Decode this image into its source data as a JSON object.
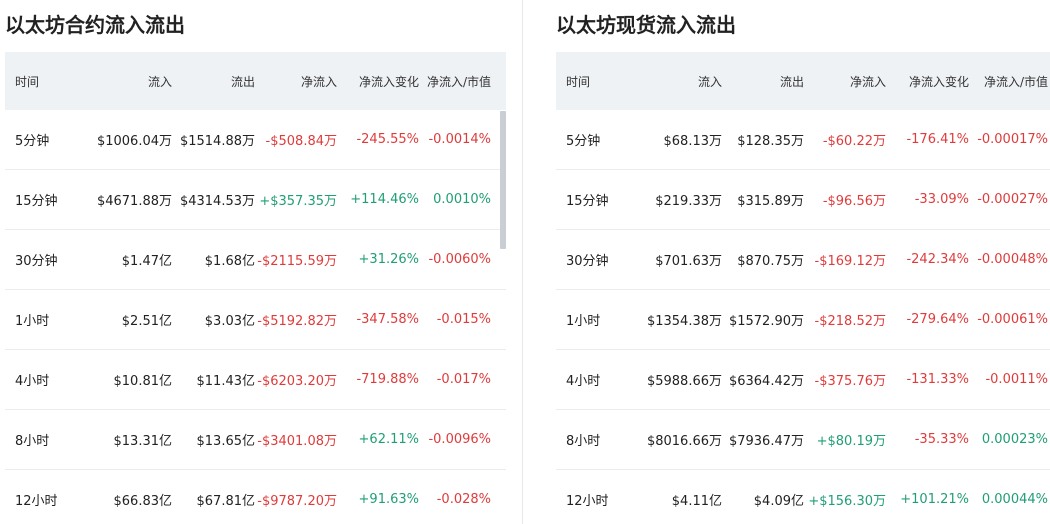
{
  "colors": {
    "negative": "#e03b3b",
    "positive": "#1f9e77",
    "header_bg": "#eff2f5"
  },
  "panels": [
    {
      "title": "以太坊合约流入流出",
      "columns": [
        "时间",
        "流入",
        "流出",
        "净流入",
        "净流入变化",
        "净流入/市值"
      ],
      "rows": [
        [
          "5分钟",
          "$1006.04万",
          "$1514.88万",
          "-$508.84万",
          "-245.55%",
          "-0.0014%"
        ],
        [
          "15分钟",
          "$4671.88万",
          "$4314.53万",
          "+$357.35万",
          "+114.46%",
          "0.0010%"
        ],
        [
          "30分钟",
          "$1.47亿",
          "$1.68亿",
          "-$2115.59万",
          "+31.26%",
          "-0.0060%"
        ],
        [
          "1小时",
          "$2.51亿",
          "$3.03亿",
          "-$5192.82万",
          "-347.58%",
          "-0.015%"
        ],
        [
          "4小时",
          "$10.81亿",
          "$11.43亿",
          "-$6203.20万",
          "-719.88%",
          "-0.017%"
        ],
        [
          "8小时",
          "$13.31亿",
          "$13.65亿",
          "-$3401.08万",
          "+62.11%",
          "-0.0096%"
        ],
        [
          "12小时",
          "$66.83亿",
          "$67.81亿",
          "-$9787.20万",
          "+91.63%",
          "-0.028%"
        ]
      ]
    },
    {
      "title": "以太坊现货流入流出",
      "columns": [
        "时间",
        "流入",
        "流出",
        "净流入",
        "净流入变化",
        "净流入/市值"
      ],
      "rows": [
        [
          "5分钟",
          "$68.13万",
          "$128.35万",
          "-$60.22万",
          "-176.41%",
          "-0.00017%"
        ],
        [
          "15分钟",
          "$219.33万",
          "$315.89万",
          "-$96.56万",
          "-33.09%",
          "-0.00027%"
        ],
        [
          "30分钟",
          "$701.63万",
          "$870.75万",
          "-$169.12万",
          "-242.34%",
          "-0.00048%"
        ],
        [
          "1小时",
          "$1354.38万",
          "$1572.90万",
          "-$218.52万",
          "-279.64%",
          "-0.00061%"
        ],
        [
          "4小时",
          "$5988.66万",
          "$6364.42万",
          "-$375.76万",
          "-131.33%",
          "-0.0011%"
        ],
        [
          "8小时",
          "$8016.66万",
          "$7936.47万",
          "+$80.19万",
          "-35.33%",
          "0.00023%"
        ],
        [
          "12小时",
          "$4.11亿",
          "$4.09亿",
          "+$156.30万",
          "+101.21%",
          "0.00044%"
        ]
      ]
    }
  ]
}
